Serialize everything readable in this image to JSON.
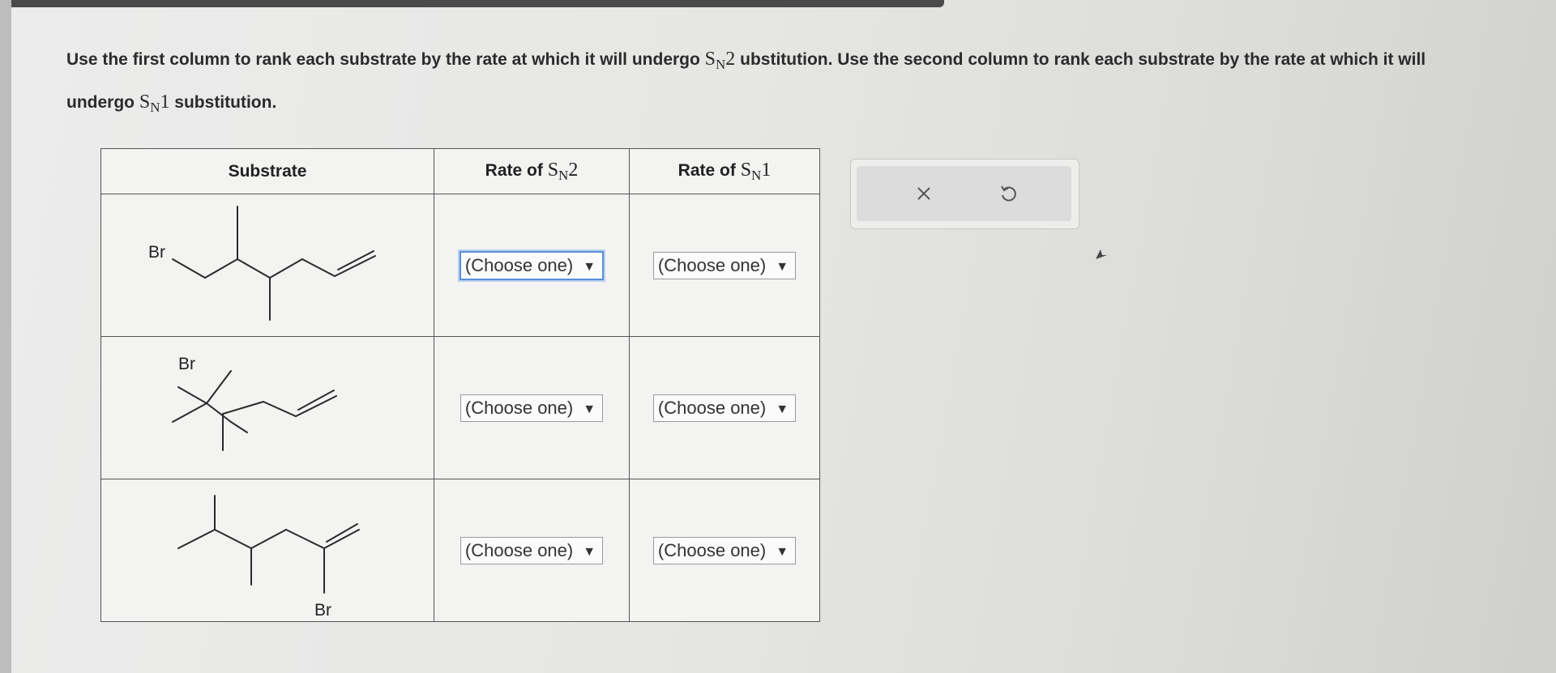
{
  "question": {
    "part1": "Use the first column to rank each substrate by the rate at which it will undergo ",
    "sn2_s": "S",
    "sn2_sub": "N",
    "sn2_num": "2",
    "part2": " ubstitution. Use the second column to rank each substrate by the rate at which it will undergo ",
    "sn1_s": "S",
    "sn1_sub": "N",
    "sn1_num": "1",
    "part3": " substitution."
  },
  "table": {
    "headers": {
      "substrate": "Substrate",
      "sn2_prefix": "Rate of ",
      "sn2_s": "S",
      "sn2_sub": "N",
      "sn2_num": "2",
      "sn1_prefix": "Rate of ",
      "sn1_s": "S",
      "sn1_sub": "N",
      "sn1_num": "1"
    },
    "rows": [
      {
        "br_label": "Br",
        "sn2_value": "(Choose one)",
        "sn1_value": "(Choose one)"
      },
      {
        "br_label": "Br",
        "sn2_value": "(Choose one)",
        "sn1_value": "(Choose one)"
      },
      {
        "br_label": "Br",
        "sn2_value": "(Choose one)",
        "sn1_value": "(Choose one)"
      }
    ],
    "dropdown_arrow": "▼"
  },
  "toolbox": {
    "clear_icon": "x-icon",
    "undo_icon": "undo-icon"
  },
  "colors": {
    "focus_border": "#5b8fd6",
    "table_border": "#555555",
    "cell_bg": "#f3f3f2"
  }
}
